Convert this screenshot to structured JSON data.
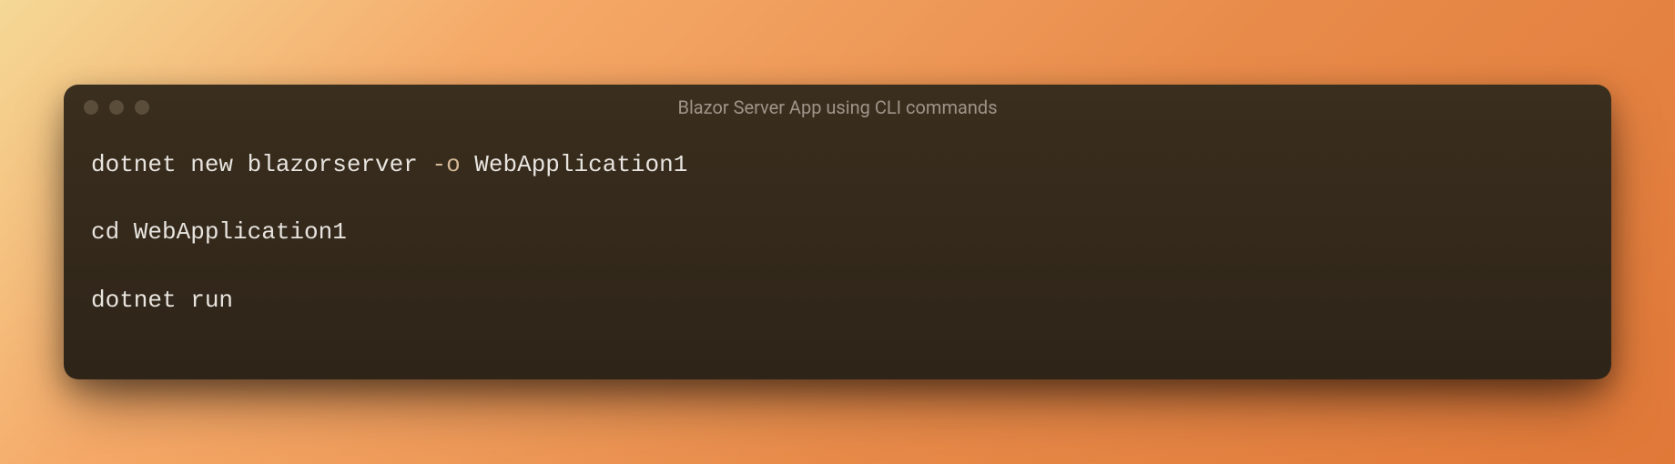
{
  "window": {
    "title": "Blazor Server App using CLI commands"
  },
  "terminal": {
    "lines": [
      {
        "cmd_part1": "dotnet new blazorserver ",
        "flag": "-o",
        "cmd_part2": " WebApplication1"
      },
      {
        "cmd_part1": "cd WebApplication1",
        "flag": "",
        "cmd_part2": ""
      },
      {
        "cmd_part1": "dotnet run",
        "flag": "",
        "cmd_part2": ""
      }
    ]
  },
  "colors": {
    "background_gradient_start": "#f5d896",
    "background_gradient_end": "#e07838",
    "terminal_bg": "#2e2418",
    "text_primary": "#e8e4df",
    "text_flag": "#d4b896",
    "title_text": "#9e9489"
  }
}
